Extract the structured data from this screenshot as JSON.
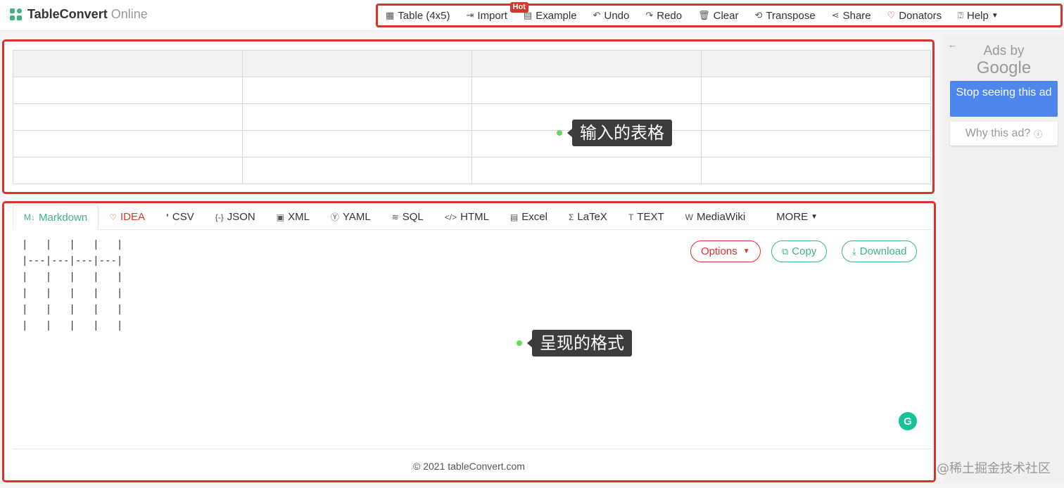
{
  "header": {
    "brand": "TableConvert",
    "brand_suffix": "Online",
    "toolbar": [
      {
        "label": "Table (4x5)",
        "icon": "table-icon"
      },
      {
        "label": "Import",
        "icon": "import-icon",
        "badge": "Hot"
      },
      {
        "label": "Example",
        "icon": "example-icon"
      },
      {
        "label": "Undo",
        "icon": "undo-icon"
      },
      {
        "label": "Redo",
        "icon": "redo-icon"
      },
      {
        "label": "Clear",
        "icon": "trash-icon"
      },
      {
        "label": "Transpose",
        "icon": "transpose-icon"
      },
      {
        "label": "Share",
        "icon": "share-icon"
      },
      {
        "label": "Donators",
        "icon": "heart-icon"
      },
      {
        "label": "Help",
        "icon": "help-icon"
      }
    ]
  },
  "input": {
    "columns": 4,
    "rows": 5,
    "tooltip": "输入的表格"
  },
  "output": {
    "tabs": [
      {
        "label": "Markdown",
        "icon_text": "M↓"
      },
      {
        "label": "IDEA",
        "icon_text": "♡"
      },
      {
        "label": "CSV",
        "icon_text": "❜"
      },
      {
        "label": "JSON",
        "icon_text": "{-}"
      },
      {
        "label": "XML",
        "icon_text": "▣"
      },
      {
        "label": "YAML",
        "icon_text": "Ⓨ"
      },
      {
        "label": "SQL",
        "icon_text": "≋"
      },
      {
        "label": "HTML",
        "icon_text": "</>"
      },
      {
        "label": "Excel",
        "icon_text": "▤"
      },
      {
        "label": "LaTeX",
        "icon_text": "Σ"
      },
      {
        "label": "TEXT",
        "icon_text": "T"
      },
      {
        "label": "MediaWiki",
        "icon_text": "W"
      },
      {
        "label": "MORE",
        "icon_text": ""
      }
    ],
    "code_lines": [
      "|   |   |   |   |",
      "|---|---|---|---|",
      "|   |   |   |   |",
      "|   |   |   |   |",
      "|   |   |   |   |",
      "|   |   |   |   |"
    ],
    "options_label": "Options",
    "copy_label": "Copy",
    "download_label": "Download",
    "tooltip": "呈现的格式",
    "footer": "© 2021 tableConvert.com"
  },
  "ad": {
    "by": "Ads by",
    "google": "Google",
    "stop": "Stop seeing this ad",
    "why": "Why this ad?"
  },
  "watermark": "@稀土掘金技术社区",
  "colors": {
    "accent_green": "#3fb27f",
    "accent_red": "#d9342b",
    "ad_blue": "#4d87ee"
  }
}
